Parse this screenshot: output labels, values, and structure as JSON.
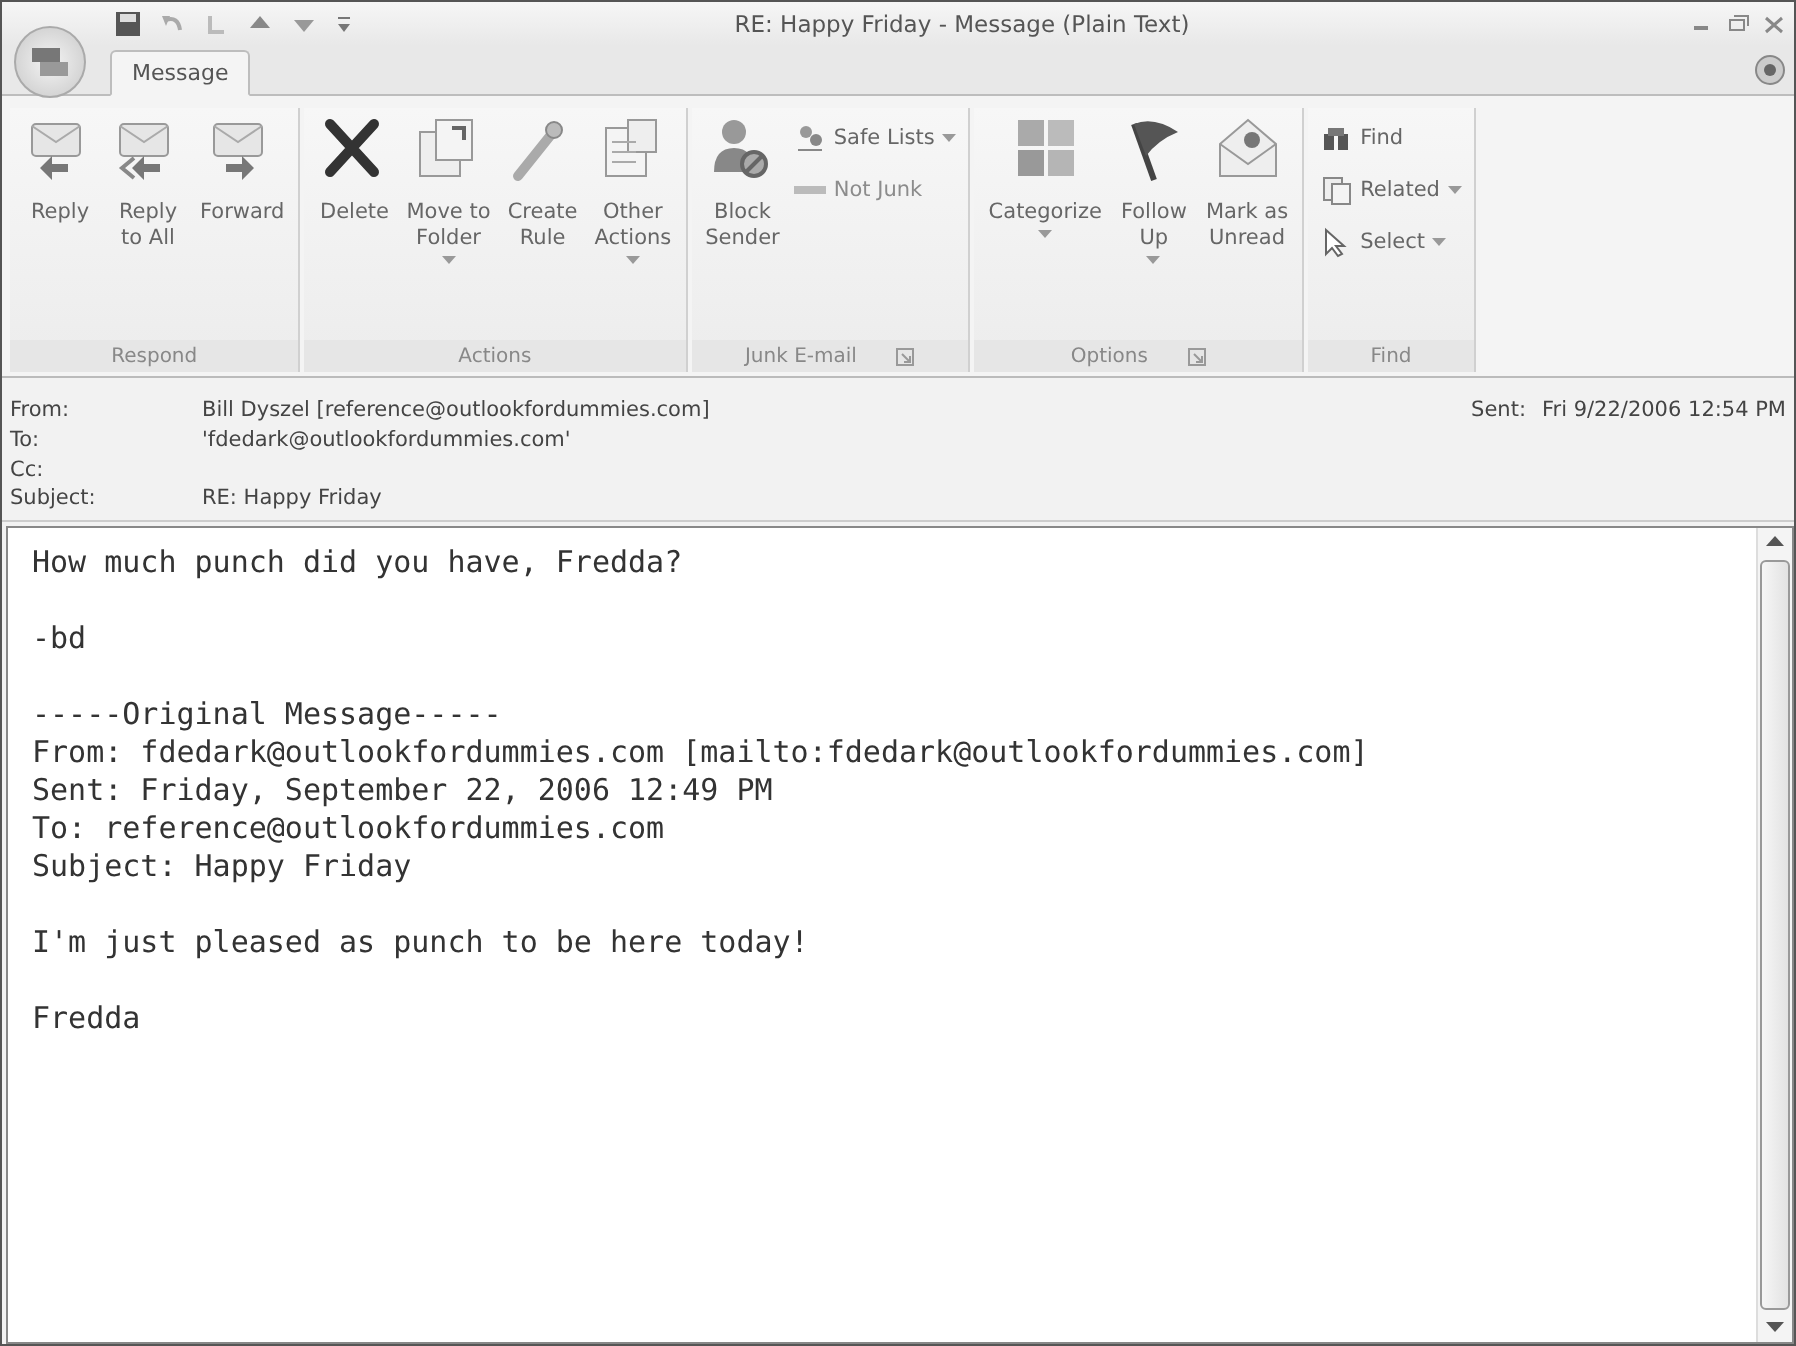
{
  "window": {
    "title": "RE: Happy Friday - Message (Plain Text)"
  },
  "tabs": [
    {
      "label": "Message",
      "selected": true
    }
  ],
  "ribbon": {
    "groups": [
      {
        "label": "Respond",
        "launcher": false,
        "buttons": [
          {
            "kind": "large",
            "label": "Reply",
            "dropdown": false,
            "disabled": false
          },
          {
            "kind": "large",
            "label": "Reply\nto All",
            "dropdown": false,
            "disabled": false
          },
          {
            "kind": "large",
            "label": "Forward",
            "dropdown": false,
            "disabled": false
          }
        ]
      },
      {
        "label": "Actions",
        "launcher": false,
        "buttons": [
          {
            "kind": "large",
            "label": "Delete",
            "dropdown": false,
            "disabled": false
          },
          {
            "kind": "large",
            "label": "Move to\nFolder",
            "dropdown": true,
            "disabled": false
          },
          {
            "kind": "large",
            "label": "Create\nRule",
            "dropdown": false,
            "disabled": false
          },
          {
            "kind": "large",
            "label": "Other\nActions",
            "dropdown": true,
            "disabled": false
          }
        ]
      },
      {
        "label": "Junk E-mail",
        "launcher": true,
        "buttons": [
          {
            "kind": "large",
            "label": "Block\nSender",
            "dropdown": false,
            "disabled": false
          },
          {
            "kind": "small",
            "label": "Safe Lists",
            "dropdown": true,
            "disabled": false
          },
          {
            "kind": "small",
            "label": "Not Junk",
            "dropdown": false,
            "disabled": true
          }
        ]
      },
      {
        "label": "Options",
        "launcher": true,
        "buttons": [
          {
            "kind": "large",
            "label": "Categorize",
            "dropdown": true,
            "disabled": false
          },
          {
            "kind": "large",
            "label": "Follow\nUp",
            "dropdown": true,
            "disabled": false
          },
          {
            "kind": "large",
            "label": "Mark as\nUnread",
            "dropdown": false,
            "disabled": false
          }
        ]
      },
      {
        "label": "Find",
        "launcher": false,
        "buttons": [
          {
            "kind": "small",
            "label": "Find",
            "dropdown": false,
            "disabled": false
          },
          {
            "kind": "small",
            "label": "Related",
            "dropdown": true,
            "disabled": false
          },
          {
            "kind": "small",
            "label": "Select",
            "dropdown": true,
            "disabled": false
          }
        ]
      }
    ]
  },
  "header": {
    "fields": [
      {
        "label": "From:",
        "value": "Bill Dyszel [reference@outlookfordummies.com]"
      },
      {
        "label": "To:",
        "value": "'fdedark@outlookfordummies.com'"
      },
      {
        "label": "Cc:"
      },
      {
        "label": "Subject:",
        "value": "RE: Happy Friday"
      }
    ],
    "sent": {
      "label": "Sent:",
      "value": "Fri 9/22/2006 12:54 PM"
    }
  },
  "body": {
    "paragraphs": [
      [
        "How much punch did you have, Fredda?"
      ],
      [
        "-bd"
      ],
      [
        "-----Original Message-----",
        "From: fdedark@outlookfordummies.com [mailto:fdedark@outlookfordummies.com]",
        "Sent: Friday, September 22, 2006 12:49 PM",
        "To: reference@outlookfordummies.com",
        "Subject: Happy Friday"
      ],
      [
        "I'm just pleased as punch to be here today!"
      ],
      [
        "Fredda"
      ]
    ]
  }
}
